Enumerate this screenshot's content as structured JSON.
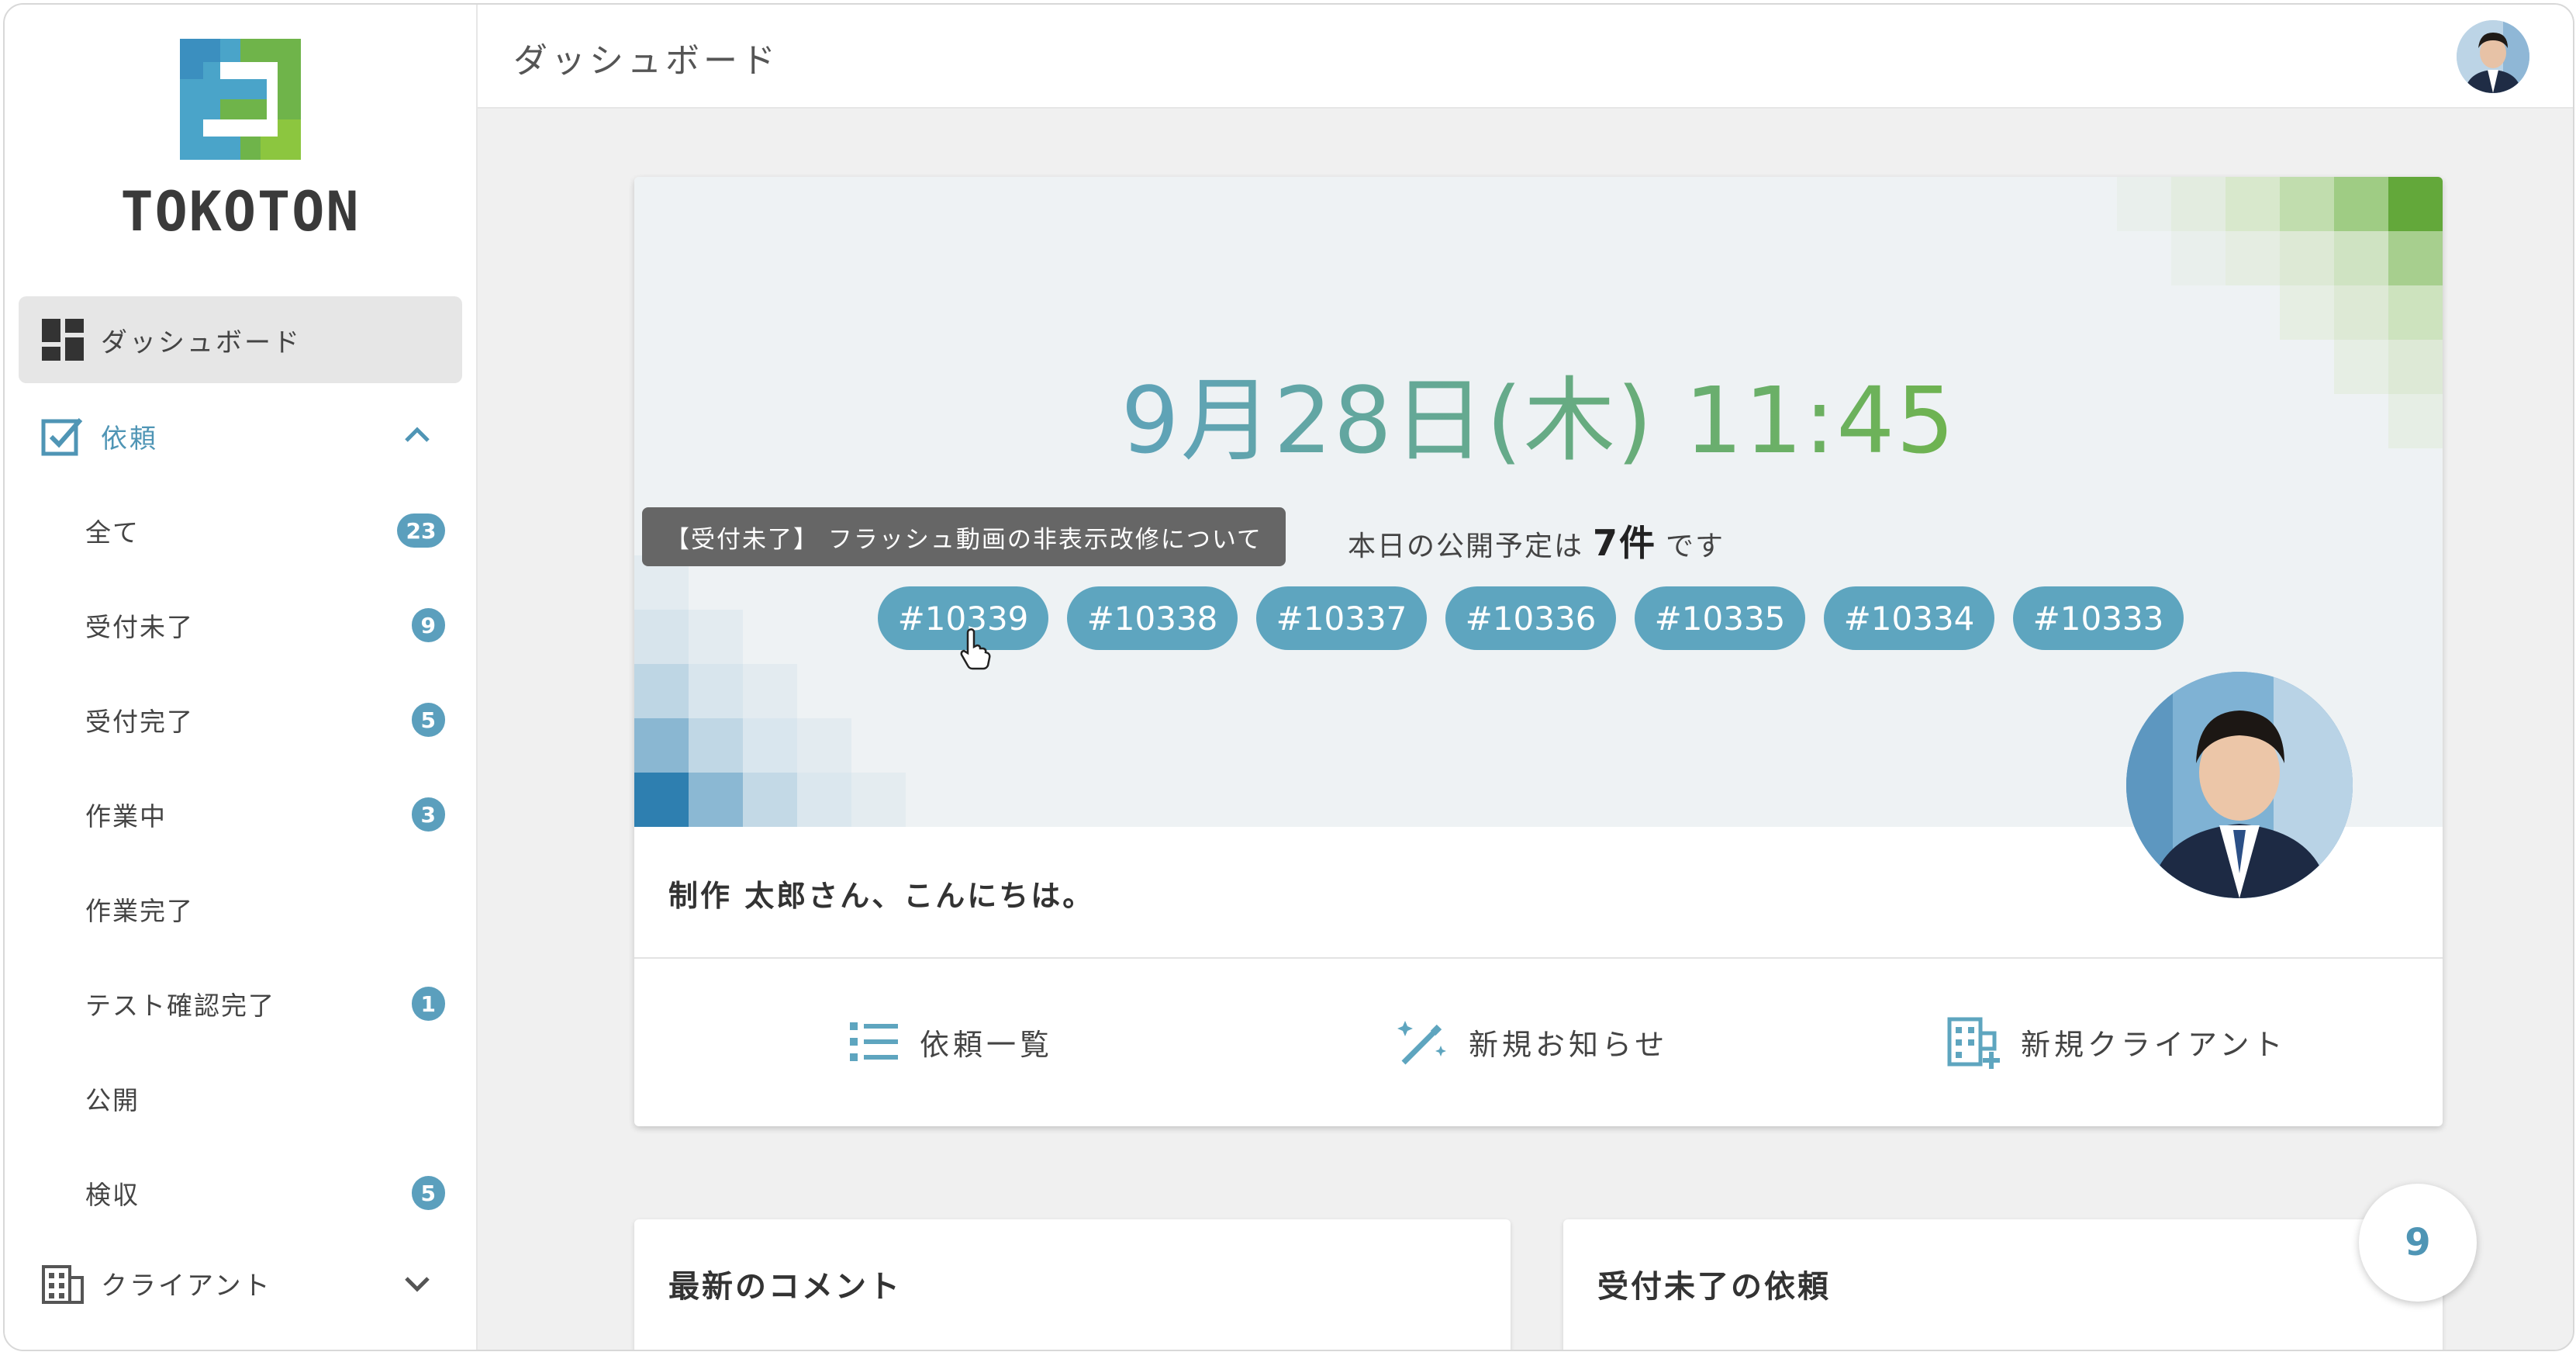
{
  "brand": {
    "logo_text": "TOKOTON"
  },
  "header": {
    "title": "ダッシュボード"
  },
  "sidebar": {
    "dashboard_label": "ダッシュボード",
    "requests_label": "依頼",
    "sub_items": [
      {
        "label": "全て",
        "count": "23"
      },
      {
        "label": "受付未了",
        "count": "9"
      },
      {
        "label": "受付完了",
        "count": "5"
      },
      {
        "label": "作業中",
        "count": "3"
      },
      {
        "label": "作業完了",
        "count": ""
      },
      {
        "label": "テスト確認完了",
        "count": "1"
      },
      {
        "label": "公開",
        "count": ""
      },
      {
        "label": "検収",
        "count": "5"
      }
    ],
    "clients_label": "クライアント"
  },
  "hero": {
    "datetime": "9月28日(木) 11:45",
    "tooltip": "【受付未了】 フラッシュ動画の非表示改修について",
    "schedule_prefix": "本日の公開予定は",
    "schedule_count": "7件",
    "schedule_suffix": "です",
    "tickets": [
      "#10339",
      "#10338",
      "#10337",
      "#10336",
      "#10335",
      "#10334",
      "#10333"
    ],
    "greeting": "制作 太郎さん、こんにちは。",
    "actions": {
      "request_list": "依頼一覧",
      "new_notice": "新規お知らせ",
      "new_client": "新規クライアント"
    }
  },
  "cards": {
    "latest_comments": "最新のコメント",
    "unaccepted_requests": "受付未了の依頼"
  },
  "fab": {
    "count": "9"
  },
  "colors": {
    "accent": "#5ea5bf",
    "green": "#6fb44a",
    "badge": "#5b9fbd"
  }
}
